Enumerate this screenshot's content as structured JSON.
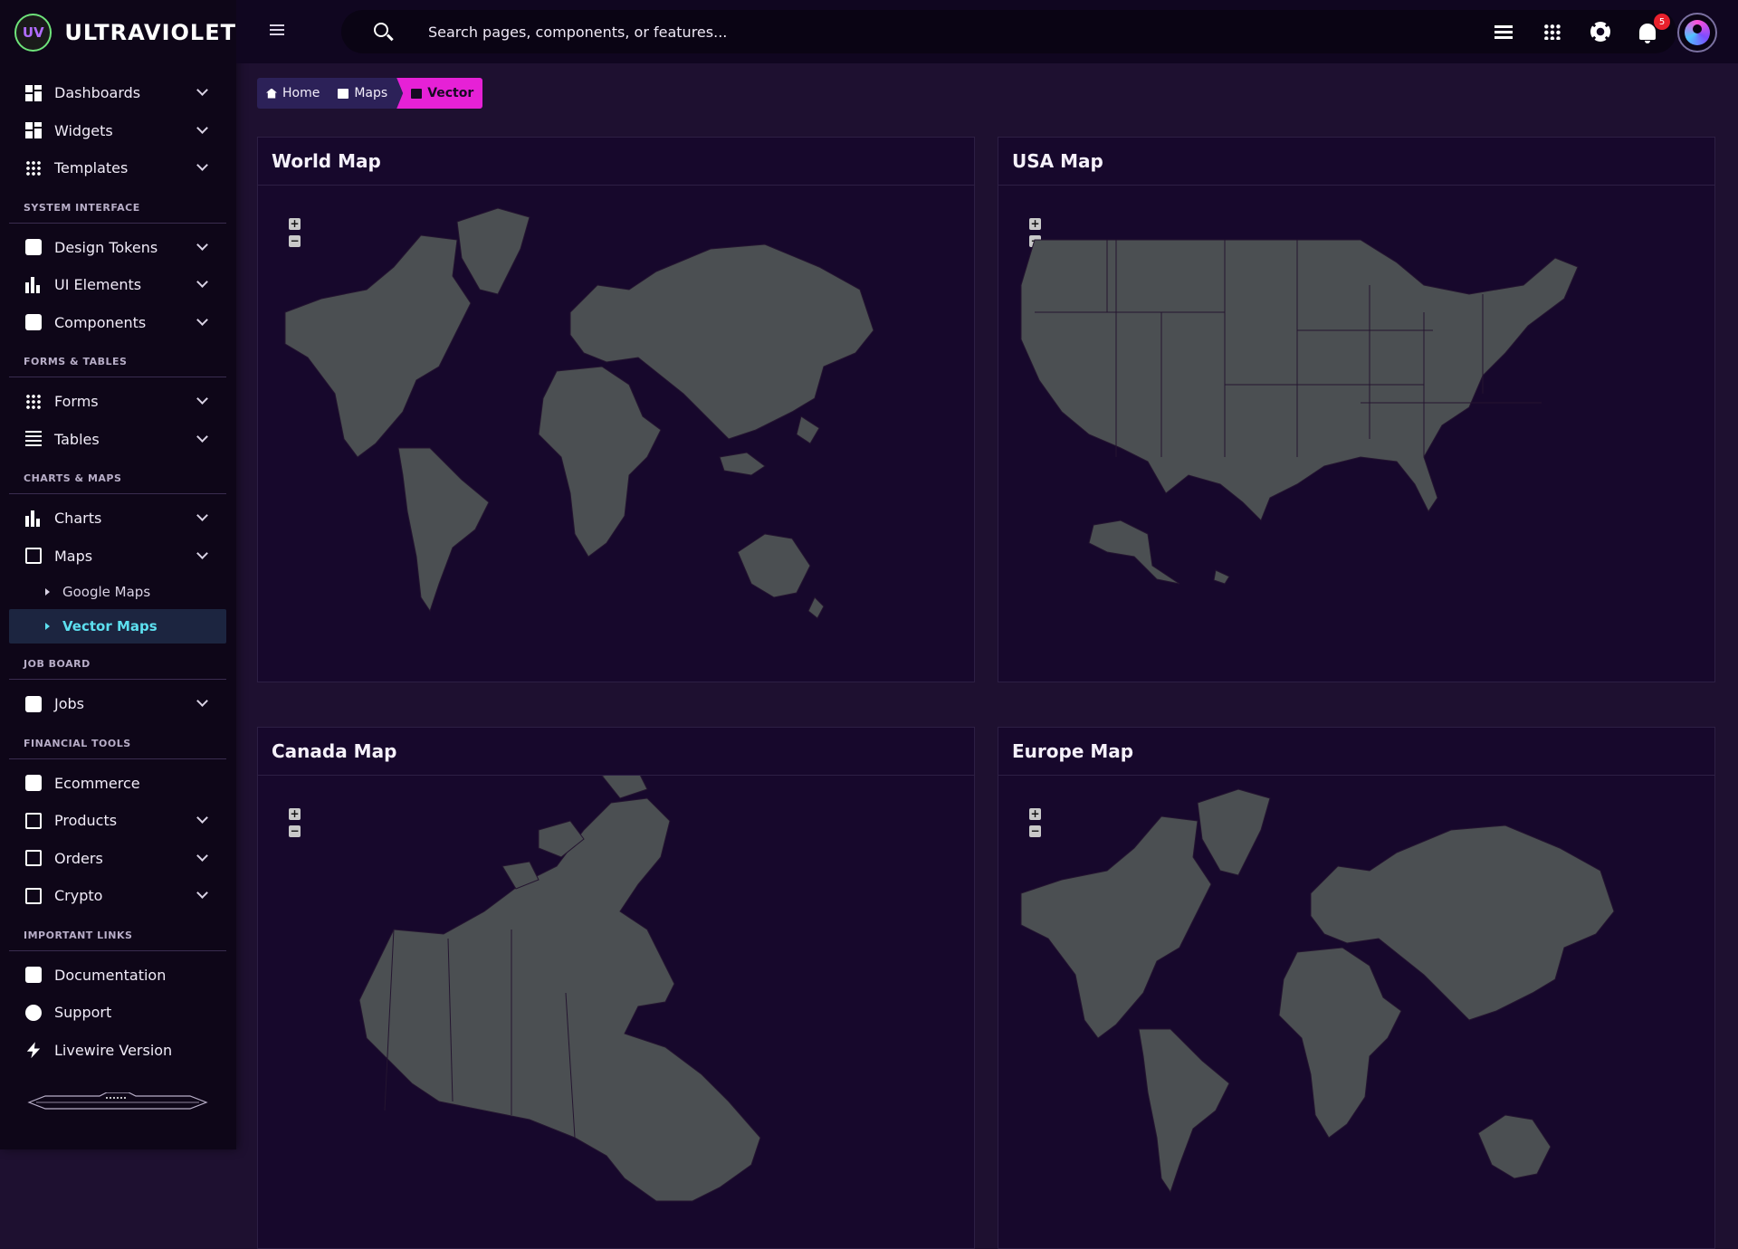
{
  "brand": {
    "logo_text": "UV",
    "name": "ULTRAVIOLET"
  },
  "sidebar": {
    "sections": [
      {
        "title": "",
        "items": [
          {
            "label": "Dashboards",
            "icon": "dashboard-icon",
            "chevron": true
          },
          {
            "label": "Widgets",
            "icon": "widgets-icon",
            "chevron": true
          },
          {
            "label": "Templates",
            "icon": "templates-icon",
            "chevron": true
          }
        ]
      },
      {
        "title": "SYSTEM INTERFACE",
        "items": [
          {
            "label": "Design Tokens",
            "icon": "paint-roller-icon",
            "chevron": true
          },
          {
            "label": "UI Elements",
            "icon": "ui-elements-icon",
            "chevron": true
          },
          {
            "label": "Components",
            "icon": "puzzle-icon",
            "chevron": true
          }
        ]
      },
      {
        "title": "FORMS & TABLES",
        "items": [
          {
            "label": "Forms",
            "icon": "forms-icon",
            "chevron": true
          },
          {
            "label": "Tables",
            "icon": "tables-icon",
            "chevron": true
          }
        ]
      },
      {
        "title": "CHARTS & MAPS",
        "items": [
          {
            "label": "Charts",
            "icon": "bar-chart-icon",
            "chevron": true
          },
          {
            "label": "Maps",
            "icon": "map-icon",
            "chevron": true
          }
        ]
      },
      {
        "title": "JOB BOARD",
        "items": [
          {
            "label": "Jobs",
            "icon": "briefcase-icon",
            "chevron": true
          }
        ]
      },
      {
        "title": "FINANCIAL TOOLS",
        "items": [
          {
            "label": "Ecommerce",
            "icon": "store-icon",
            "chevron": false
          },
          {
            "label": "Products",
            "icon": "products-icon",
            "chevron": true
          },
          {
            "label": "Orders",
            "icon": "orders-icon",
            "chevron": true
          },
          {
            "label": "Crypto",
            "icon": "wallet-icon",
            "chevron": true
          }
        ]
      },
      {
        "title": "IMPORTANT LINKS",
        "items": [
          {
            "label": "Documentation",
            "icon": "document-icon",
            "chevron": false
          },
          {
            "label": "Support",
            "icon": "help-icon",
            "chevron": false
          },
          {
            "label": "Livewire Version",
            "icon": "bolt-icon",
            "chevron": false
          }
        ]
      }
    ],
    "maps_submenu": [
      {
        "label": "Google Maps",
        "active": false
      },
      {
        "label": "Vector Maps",
        "active": true
      }
    ]
  },
  "topbar": {
    "search_placeholder": "Search pages, components, or features...",
    "notification_count": "5"
  },
  "breadcrumb": [
    {
      "label": "Home",
      "icon": "home-icon"
    },
    {
      "label": "Maps",
      "icon": "folder-icon"
    },
    {
      "label": "Vector",
      "icon": "grid-icon",
      "active": true
    }
  ],
  "cards": [
    {
      "title": "World Map"
    },
    {
      "title": "USA Map"
    },
    {
      "title": "Canada Map"
    },
    {
      "title": "Europe Map"
    }
  ],
  "zoom": {
    "plus": "+",
    "minus": "−"
  },
  "colors": {
    "background": "#1e1030",
    "sidebar": "#0e0618",
    "card": "#17082c",
    "land": "#4b4f52",
    "accent_pink": "#e621d6",
    "active_cyan": "#5de0f0",
    "badge_red": "#e8202c"
  }
}
